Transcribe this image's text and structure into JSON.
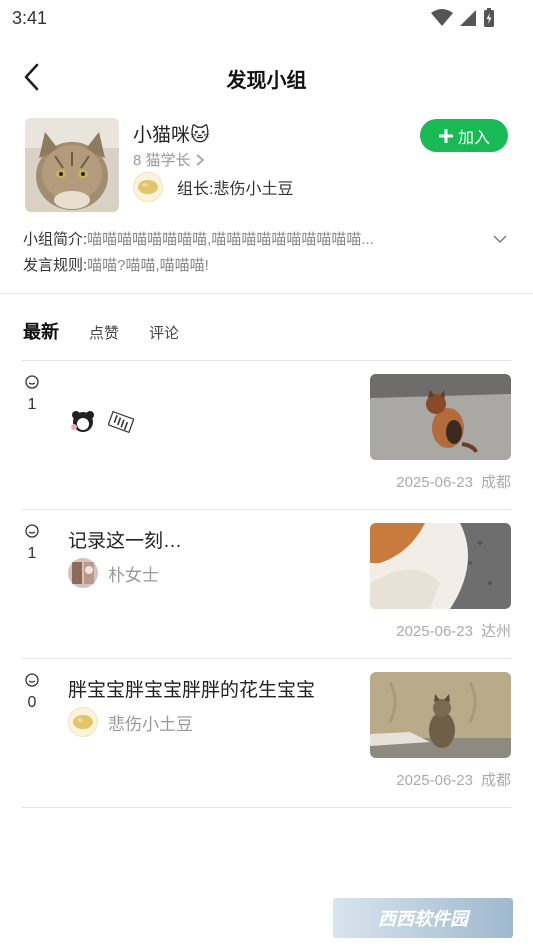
{
  "status_bar": {
    "time": "3:41"
  },
  "nav": {
    "title": "发现小组"
  },
  "group": {
    "name": "小猫咪🐱",
    "level": "8 猫学长",
    "leader_label": "组长:悲伤小土豆",
    "join_label": "加入",
    "intro_key": "小组简介:",
    "intro_value": "喵喵喵喵喵喵喵喵,喵喵喵喵喵喵喵喵喵喵...",
    "rules_key": "发言规则:",
    "rules_value": "喵喵?喵喵,喵喵喵!"
  },
  "tabs": [
    "最新",
    "点赞",
    "评论"
  ],
  "posts": [
    {
      "comment_count": "1",
      "title": "",
      "author": "",
      "date": "2025-06-23",
      "city": "成都"
    },
    {
      "comment_count": "1",
      "title": "记录这一刻…",
      "author": "朴女士",
      "date": "2025-06-23",
      "city": "达州"
    },
    {
      "comment_count": "0",
      "title": "胖宝宝胖宝宝胖胖的花生宝宝",
      "author": "悲伤小土豆",
      "date": "2025-06-23",
      "city": "成都"
    }
  ],
  "watermark": {
    "text": "西西软件园"
  },
  "colors": {
    "accent_green": "#19b955"
  }
}
